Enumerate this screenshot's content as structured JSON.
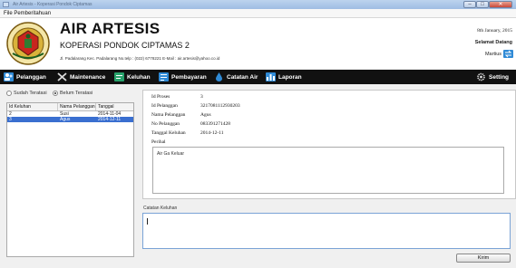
{
  "window": {
    "title": "Air Artesis - Koperasi Pondok Ciptamas"
  },
  "menu": {
    "items": [
      {
        "label": "File  Pemberitahuan"
      }
    ]
  },
  "header": {
    "title": "AIR ARTESIS",
    "subtitle": "KOPERASI PONDOK CIPTAMAS 2",
    "address": "Jl. Padalarang Kec. Padalarang No.telp : (022) 6778221 E-Mail : air.artesis@yahoo.co.id",
    "date": "8th January, 2015",
    "welcome": "Selamat Datang",
    "user": "Martius"
  },
  "nav": {
    "pelanggan": "Pelanggan",
    "maintenance": "Maintenance",
    "keluhan": "Keluhan",
    "pembayaran": "Pembayaran",
    "catatan_air": "Catatan Air",
    "laporan": "Laporan",
    "setting": "Setting"
  },
  "filter": {
    "sudah": "Sudah Teratasi",
    "belum": "Belum Teratasi",
    "selected": "belum"
  },
  "table": {
    "columns": [
      "Id Keluhan",
      "Nama Pelanggan",
      "Tanggal"
    ],
    "rows": [
      {
        "id": "2",
        "nama": "Susi",
        "tanggal": "2014-11-04"
      },
      {
        "id": "3",
        "nama": "Agus",
        "tanggal": "2014-12-11"
      }
    ],
    "selected_row": 1
  },
  "detail": {
    "labels": {
      "id_proses": "Id Proses",
      "id_pelanggan": "Id Pelanggan",
      "nama": "Nama Pelanggan",
      "telp": "No Pelanggan",
      "tanggal": "Tanggal Keluhan",
      "perihal": "Perihal"
    },
    "values": {
      "id_proses": "3",
      "id_pelanggan": "3217081112930203",
      "nama": "Agus",
      "telp": "083391271428",
      "tanggal": "2014-12-11"
    },
    "perihal_text": "Air Ga Keluar"
  },
  "catatan": {
    "label": "Catatan Keluhan",
    "value": ""
  },
  "kirim": "Kirim",
  "colors": {
    "nav_bg": "#111111",
    "selection": "#3a6fd0",
    "accent_blue": "#2f8ad6"
  }
}
